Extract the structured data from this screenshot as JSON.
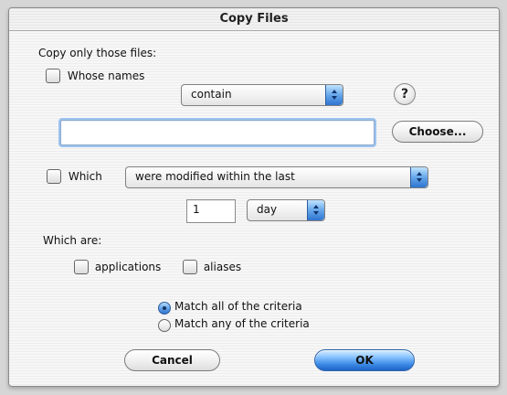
{
  "window": {
    "title": "Copy Files"
  },
  "section": {
    "heading": "Copy only those files:"
  },
  "whose_names": {
    "checkbox_label": "Whose names",
    "checked": false,
    "operator": "contain",
    "text_value": "",
    "choose_label": "Choose...",
    "help_label": "?"
  },
  "which": {
    "checkbox_label": "Which",
    "checked": false,
    "condition": "were modified within the last",
    "amount": "1",
    "unit": "day"
  },
  "which_are": {
    "label": "Which are:",
    "options": [
      {
        "label": "applications",
        "checked": false
      },
      {
        "label": "aliases",
        "checked": false
      }
    ]
  },
  "match": {
    "options": [
      {
        "label": "Match all of the criteria",
        "selected": true
      },
      {
        "label": "Match any of the criteria",
        "selected": false
      }
    ]
  },
  "actions": {
    "cancel_label": "Cancel",
    "ok_label": "OK"
  },
  "icons": {
    "help": "help-icon",
    "popup_arrow": "popup-arrow-icon"
  },
  "colors": {
    "accent": "#3c8ae5",
    "focus": "#9cc3f0"
  }
}
